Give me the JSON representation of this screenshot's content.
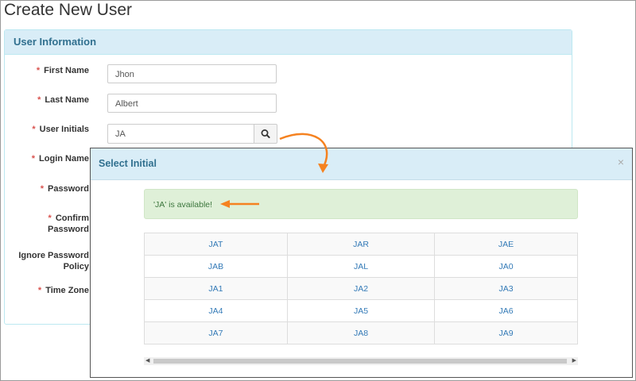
{
  "page": {
    "title": "Create New User"
  },
  "panel": {
    "title": "User Information"
  },
  "form": {
    "required_mark": "*",
    "first_name": {
      "label": "First Name",
      "value": "Jhon"
    },
    "last_name": {
      "label": "Last Name",
      "value": "Albert"
    },
    "user_initials": {
      "label": "User Initials",
      "value": "JA"
    },
    "login_name": {
      "label": "Login Name"
    },
    "password": {
      "label": "Password"
    },
    "confirm_password": {
      "label_line1": "Confirm",
      "label_line2": "Password"
    },
    "ignore_policy": {
      "label_line1": "Ignore Password",
      "label_line2": "Policy"
    },
    "time_zone": {
      "label": "Time Zone"
    }
  },
  "modal": {
    "title": "Select Initial",
    "close": "×",
    "availability_message": "'JA' is available!",
    "initials": [
      [
        "JAT",
        "JAR",
        "JAE"
      ],
      [
        "JAB",
        "JAL",
        "JA0"
      ],
      [
        "JA1",
        "JA2",
        "JA3"
      ],
      [
        "JA4",
        "JA5",
        "JA6"
      ],
      [
        "JA7",
        "JA8",
        "JA9"
      ]
    ]
  },
  "colors": {
    "annotation_arrow": "#f58220",
    "accent": "#31708f",
    "success": "#3c763d"
  }
}
